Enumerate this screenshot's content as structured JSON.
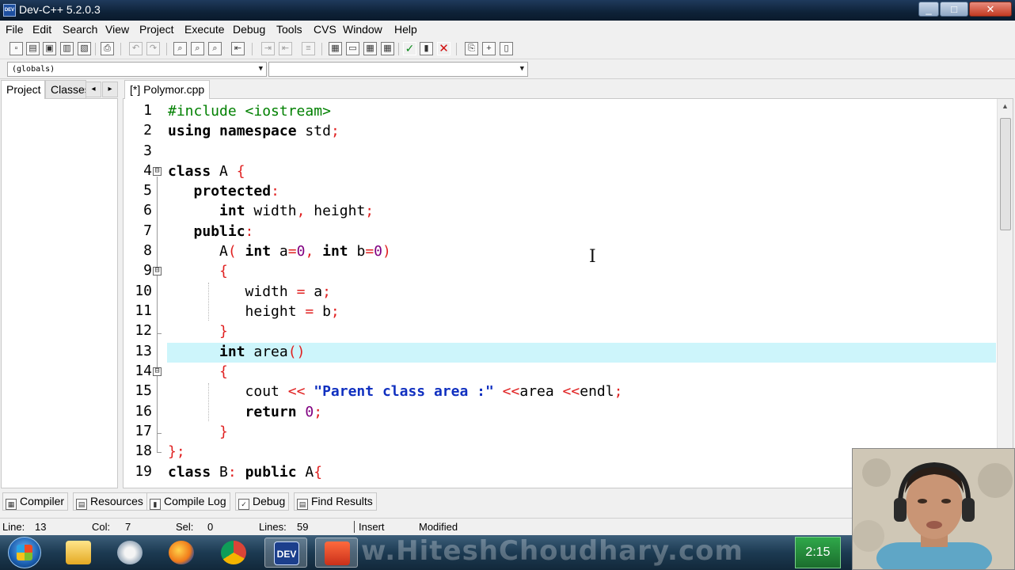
{
  "window": {
    "title": "Dev-C++ 5.2.0.3",
    "app_icon_text": "DEV",
    "minimize": "_",
    "maximize": "□",
    "close": "✕"
  },
  "menu": [
    "File",
    "Edit",
    "Search",
    "View",
    "Project",
    "Execute",
    "Debug",
    "Tools",
    "CVS",
    "Window",
    "Help"
  ],
  "toolbar_icons": [
    "new-file-icon",
    "open-icon",
    "save-icon",
    "save-all-icon",
    "close-file-icon",
    "print-icon",
    "undo-icon",
    "redo-icon",
    "find-icon",
    "replace-icon",
    "find-next-icon",
    "goto-line-icon",
    "indent-icon",
    "unindent-icon",
    "toggle-comment-icon",
    "new-project-icon",
    "compile-icon",
    "run-icon",
    "compile-run-icon",
    "rebuild-icon",
    "syntax-check-icon",
    "chart-icon",
    "stop-icon",
    "debug-icon",
    "add-watch-icon",
    "bookmark-icon"
  ],
  "combos": {
    "scope_value": "(globals)",
    "member_value": ""
  },
  "left_panel": {
    "tabs": [
      "Project",
      "Classes"
    ],
    "active_tab": "Project",
    "nav_left": "◂",
    "nav_right": "▸"
  },
  "editor": {
    "tab_label": "[*] Polymor.cpp",
    "line_numbers": [
      "1",
      "2",
      "3",
      "4",
      "5",
      "6",
      "7",
      "8",
      "9",
      "10",
      "11",
      "12",
      "13",
      "14",
      "15",
      "16",
      "17",
      "18",
      "19"
    ],
    "fold_markers": [
      "⊟",
      "⊟",
      "⊟"
    ],
    "lines_text": [
      "#include <iostream>",
      "using namespace std;",
      "",
      "class A {",
      "   protected:",
      "      int width, height;",
      "   public:",
      "      A( int a=0, int b=0)",
      "      {",
      "         width = a;",
      "         height = b;",
      "      }",
      "      int area()",
      "      {",
      "         cout << \"Parent class area :\" <<area <<endl;",
      "         return 0;",
      "      }",
      "};",
      "class B: public A{"
    ],
    "current_line": 13
  },
  "bottom_tabs": [
    {
      "label": "Compiler",
      "icon": "compiler-grid-icon"
    },
    {
      "label": "Resources",
      "icon": "resources-icon"
    },
    {
      "label": "Compile Log",
      "icon": "compile-log-chart-icon"
    },
    {
      "label": "Debug",
      "icon": "debug-check-icon"
    },
    {
      "label": "Find Results",
      "icon": "find-results-icon"
    }
  ],
  "status": {
    "line_label": "Line:",
    "line_value": "13",
    "col_label": "Col:",
    "col_value": "7",
    "sel_label": "Sel:",
    "sel_value": "0",
    "lines_label": "Lines:",
    "lines_value": "59",
    "mode": "Insert",
    "modified": "Modified"
  },
  "taskbar": {
    "apps": [
      "windows-explorer-icon",
      "paint-icon",
      "firefox-icon",
      "chrome-icon",
      "devcpp-icon",
      "app-icon"
    ],
    "devcpp_label": "DEV",
    "clock": "2:15",
    "watermark": "w.HiteshChoudhary.com"
  }
}
